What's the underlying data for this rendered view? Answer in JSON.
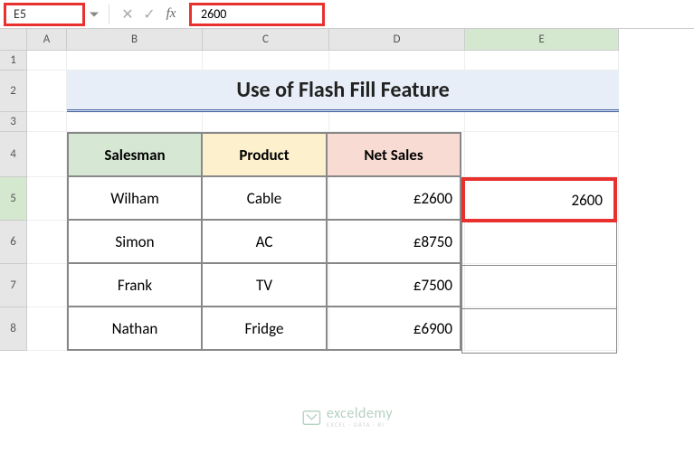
{
  "nameBox": "E5",
  "formulaValue": "2600",
  "columns": [
    "A",
    "B",
    "C",
    "D",
    "E"
  ],
  "rows": [
    "1",
    "2",
    "3",
    "4",
    "5",
    "6",
    "7",
    "8"
  ],
  "title": "Use of Flash Fill Feature",
  "headers": {
    "salesman": "Salesman",
    "product": "Product",
    "netSales": "Net Sales"
  },
  "data": [
    {
      "salesman": "Wilham",
      "product": "Cable",
      "netSales": "£2600",
      "extracted": "2600"
    },
    {
      "salesman": "Simon",
      "product": "AC",
      "netSales": "£8750",
      "extracted": ""
    },
    {
      "salesman": "Frank",
      "product": "TV",
      "netSales": "£7500",
      "extracted": ""
    },
    {
      "salesman": "Nathan",
      "product": "Fridge",
      "netSales": "£6900",
      "extracted": ""
    }
  ],
  "selectedCellValue": "2600",
  "watermark": {
    "main": "exceldemy",
    "sub": "EXCEL · DATA · BI"
  }
}
